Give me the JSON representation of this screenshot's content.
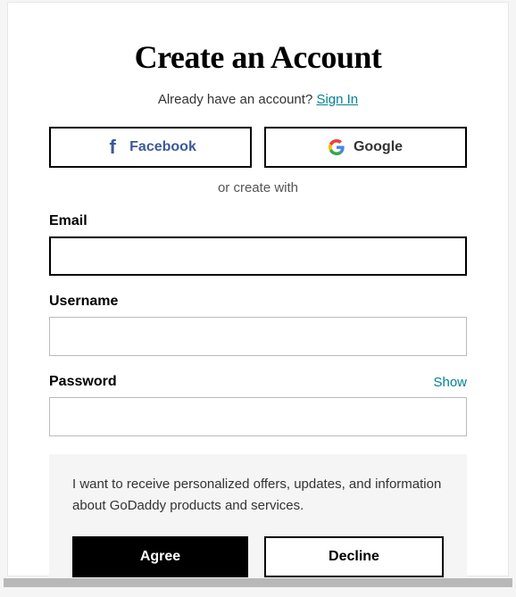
{
  "title": "Create an Account",
  "already": {
    "text": "Already have an account? ",
    "link": "Sign In"
  },
  "social": {
    "facebook_label": "Facebook",
    "google_label": "Google"
  },
  "or_text": "or create with",
  "fields": {
    "email_label": "Email",
    "email_value": "",
    "username_label": "Username",
    "username_value": "",
    "password_label": "Password",
    "password_value": "",
    "show_label": "Show"
  },
  "consent": {
    "text": "I want to receive personalized offers, updates, and information about GoDaddy products and services.",
    "agree_label": "Agree",
    "decline_label": "Decline"
  }
}
